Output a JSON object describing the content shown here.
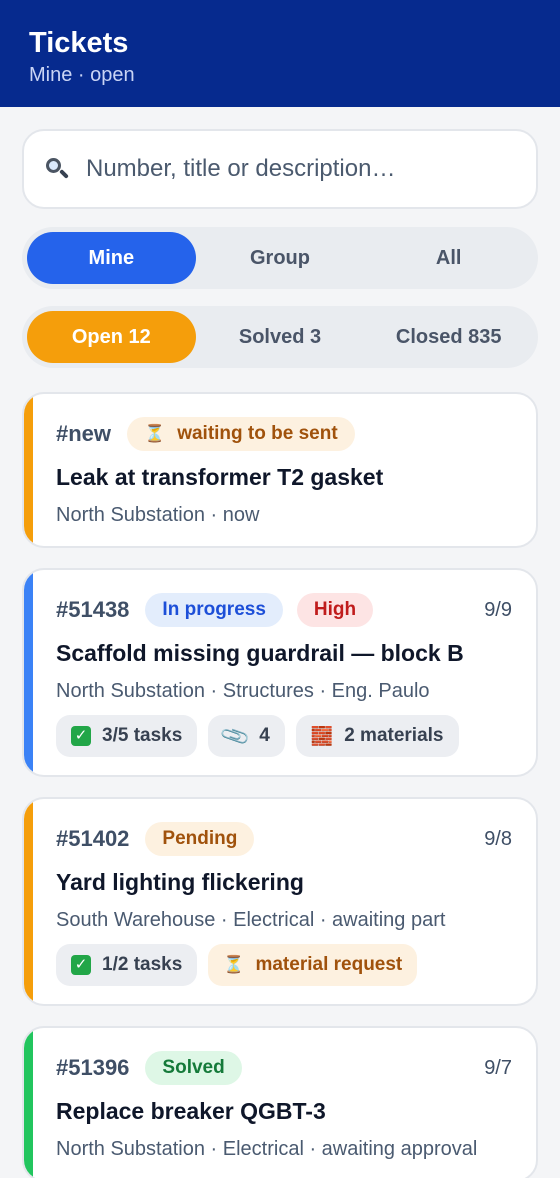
{
  "header": {
    "title": "Tickets",
    "subtitle": "Mine · open"
  },
  "search": {
    "placeholder": "Number, title or description…",
    "icon": "magnifier"
  },
  "scope_tabs": [
    {
      "label": "Mine",
      "active": true
    },
    {
      "label": "Group",
      "active": false
    },
    {
      "label": "All",
      "active": false
    }
  ],
  "status_tabs": [
    {
      "label": "Open 12",
      "active": true
    },
    {
      "label": "Solved 3",
      "active": false
    },
    {
      "label": "Closed 835",
      "active": false
    }
  ],
  "tickets": [
    {
      "number": "#new",
      "badges": [
        {
          "label": "waiting to be sent",
          "icon": "hourglass"
        }
      ],
      "date": "",
      "title": "Leak at transformer T2 gasket",
      "meta": "North Substation · now",
      "chips": []
    },
    {
      "number": "#51438",
      "badges": [
        {
          "label": "In progress"
        },
        {
          "label": "High"
        }
      ],
      "date": "9/9",
      "title": "Scaffold missing guardrail — block B",
      "meta": "North Substation · Structures · Eng. Paulo",
      "chips": [
        {
          "label": "3/5 tasks",
          "icon": "check-box"
        },
        {
          "label": "4",
          "icon": "paperclip"
        },
        {
          "label": "2 materials",
          "icon": "bricks"
        }
      ]
    },
    {
      "number": "#51402",
      "badges": [
        {
          "label": "Pending"
        }
      ],
      "date": "9/8",
      "title": "Yard lighting flickering",
      "meta": "South Warehouse · Electrical · awaiting part",
      "chips": [
        {
          "label": "1/2 tasks",
          "icon": "check-box"
        },
        {
          "label": "material request",
          "icon": "hourglass"
        }
      ]
    },
    {
      "number": "#51396",
      "badges": [
        {
          "label": "Solved"
        }
      ],
      "date": "9/7",
      "title": "Replace breaker QGBT-3",
      "meta": "North Substation · Electrical · awaiting approval",
      "chips": []
    }
  ],
  "colors": {
    "header_bg": "#062a8e",
    "accent_blue": "#2563eb",
    "accent_orange": "#f59e0b",
    "stripe_pending": "#f59e0b",
    "stripe_in_progress": "#3b82f6",
    "stripe_solved": "#22c55e",
    "badge_in_progress_bg": "#e3edfc",
    "badge_in_progress_fg": "#1d4fd8",
    "badge_high_bg": "#fde4e4",
    "badge_high_fg": "#c01c1c",
    "badge_pending_bg": "#fdf1e0",
    "badge_pending_fg": "#a0520c",
    "badge_solved_bg": "#def7e6",
    "badge_solved_fg": "#157a3a"
  }
}
